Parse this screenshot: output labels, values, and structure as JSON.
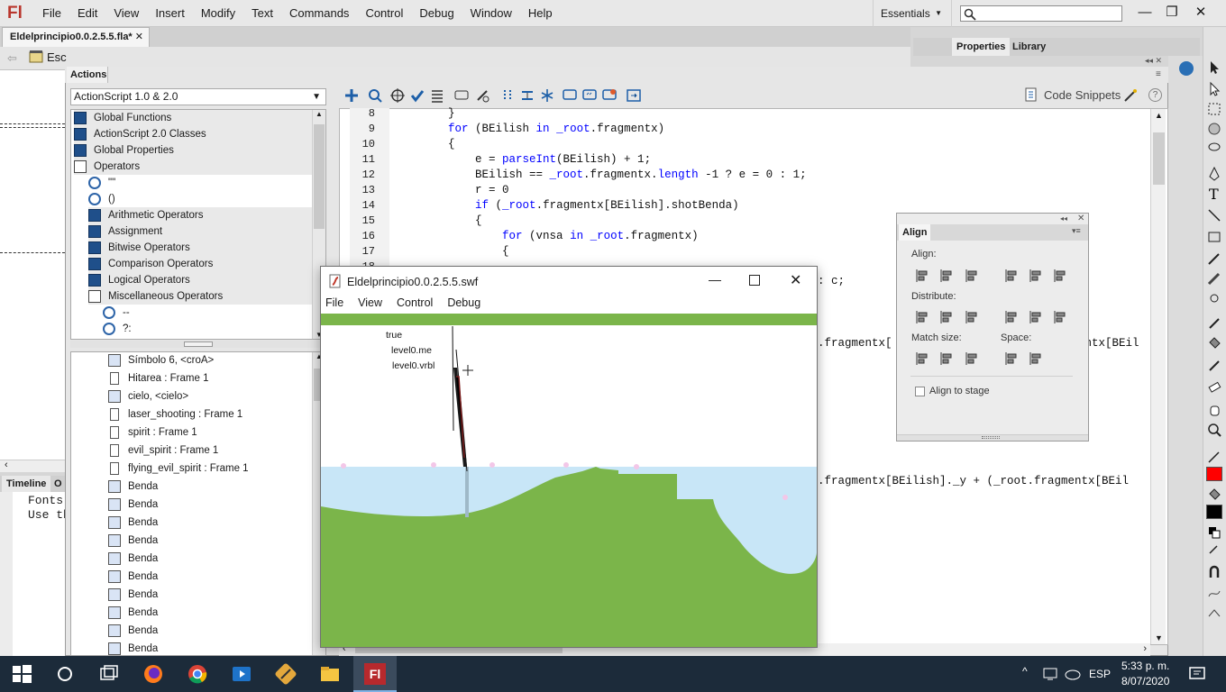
{
  "app": {
    "logo": "Fl",
    "menus": [
      "File",
      "Edit",
      "View",
      "Insert",
      "Modify",
      "Text",
      "Commands",
      "Control",
      "Debug",
      "Window",
      "Help"
    ],
    "workspace": "Essentials",
    "document_tab": "Eldelprincipio0.0.2.5.5.fla*",
    "breadcrumb": "Esc"
  },
  "right_panel": {
    "tabs": [
      "Properties",
      "Library"
    ]
  },
  "timeline": {
    "tabs": [
      "Timeline",
      "O"
    ],
    "output_lines": [
      "Fonts s",
      "Use th"
    ]
  },
  "actions": {
    "title": "Actions",
    "language": "ActionScript 1.0 & 2.0",
    "toolbox_items": [
      {
        "label": "Global Functions",
        "level": 0
      },
      {
        "label": "ActionScript 2.0 Classes",
        "level": 0
      },
      {
        "label": "Global Properties",
        "level": 0
      },
      {
        "label": "Operators",
        "level": 0
      },
      {
        "label": "\"\"",
        "level": 1
      },
      {
        "label": "()",
        "level": 1
      },
      {
        "label": "Arithmetic Operators",
        "level": 1
      },
      {
        "label": "Assignment",
        "level": 1
      },
      {
        "label": "Bitwise Operators",
        "level": 1
      },
      {
        "label": "Comparison Operators",
        "level": 1
      },
      {
        "label": "Logical Operators",
        "level": 1
      },
      {
        "label": "Miscellaneous Operators",
        "level": 1
      },
      {
        "label": "--",
        "level": 2
      },
      {
        "label": "?:",
        "level": 2
      }
    ],
    "script_items": [
      "Símbolo 6, <croA>",
      "Hitarea : Frame 1",
      "cielo, <cielo>",
      "laser_shooting : Frame 1",
      "spirit : Frame 1",
      "evil_spirit : Frame 1",
      "flying_evil_spirit : Frame 1",
      "Benda",
      "Benda",
      "Benda",
      "Benda",
      "Benda",
      "Benda",
      "Benda",
      "Benda",
      "Benda",
      "Benda"
    ],
    "code_snippets_label": "Code Snippets",
    "line_numbers": [
      "8",
      "9",
      "10",
      "11",
      "12",
      "13",
      "14",
      "15",
      "16",
      "17",
      "18"
    ],
    "code_lines": [
      {
        "indent": "        ",
        "segments": [
          {
            "t": "}",
            "c": ""
          }
        ]
      },
      {
        "indent": "        ",
        "segments": [
          {
            "t": "for",
            "c": "kw"
          },
          {
            "t": " (BEilish ",
            "c": ""
          },
          {
            "t": "in",
            "c": "kw"
          },
          {
            "t": " ",
            "c": ""
          },
          {
            "t": "_root",
            "c": "rt"
          },
          {
            "t": ".fragmentx)",
            "c": ""
          }
        ]
      },
      {
        "indent": "        ",
        "segments": [
          {
            "t": "{",
            "c": ""
          }
        ]
      },
      {
        "indent": "            ",
        "segments": [
          {
            "t": "e = ",
            "c": ""
          },
          {
            "t": "parseInt",
            "c": "kw"
          },
          {
            "t": "(BEilish) + 1;",
            "c": ""
          }
        ]
      },
      {
        "indent": "            ",
        "segments": [
          {
            "t": "BEilish == ",
            "c": ""
          },
          {
            "t": "_root",
            "c": "rt"
          },
          {
            "t": ".fragmentx.",
            "c": ""
          },
          {
            "t": "length",
            "c": "kw"
          },
          {
            "t": " -1 ? e = 0 : 1;",
            "c": ""
          }
        ]
      },
      {
        "indent": "            ",
        "segments": [
          {
            "t": "r = 0",
            "c": ""
          }
        ]
      },
      {
        "indent": "            ",
        "segments": [
          {
            "t": "if",
            "c": "kw"
          },
          {
            "t": " (",
            "c": ""
          },
          {
            "t": "_root",
            "c": "rt"
          },
          {
            "t": ".fragmentx[BEilish].shotBenda)",
            "c": ""
          }
        ]
      },
      {
        "indent": "            ",
        "segments": [
          {
            "t": "{",
            "c": ""
          }
        ]
      },
      {
        "indent": "                ",
        "segments": [
          {
            "t": "for",
            "c": "kw"
          },
          {
            "t": " (vnsa ",
            "c": ""
          },
          {
            "t": "in",
            "c": "kw"
          },
          {
            "t": " ",
            "c": ""
          },
          {
            "t": "_root",
            "c": "rt"
          },
          {
            "t": ".fragmentx)",
            "c": ""
          }
        ]
      },
      {
        "indent": "                ",
        "segments": [
          {
            "t": "{",
            "c": ""
          }
        ]
      }
    ],
    "code_fragments": {
      "line18_right": ": c;",
      "line_a_left": ".fragmentx[",
      "line_a_right": "entx[BEil",
      "line_b": ".fragmentx[BEilish]._y + (_root.fragmentx[BEil"
    }
  },
  "swf_player": {
    "title": "Eldelprincipio0.0.2.5.5.swf",
    "menus": [
      "File",
      "View",
      "Control",
      "Debug"
    ],
    "debug_text": [
      "true",
      "level0.me",
      "level0.vrbl"
    ]
  },
  "align_panel": {
    "tab": "Align",
    "sections": [
      "Align:",
      "Distribute:",
      "Match size:",
      "Space:"
    ],
    "align_to_stage": "Align to stage",
    "align_to_stage_checked": false
  },
  "taskbar": {
    "language": "ESP",
    "time": "5:33 p. m.",
    "date": "8/07/2020"
  }
}
